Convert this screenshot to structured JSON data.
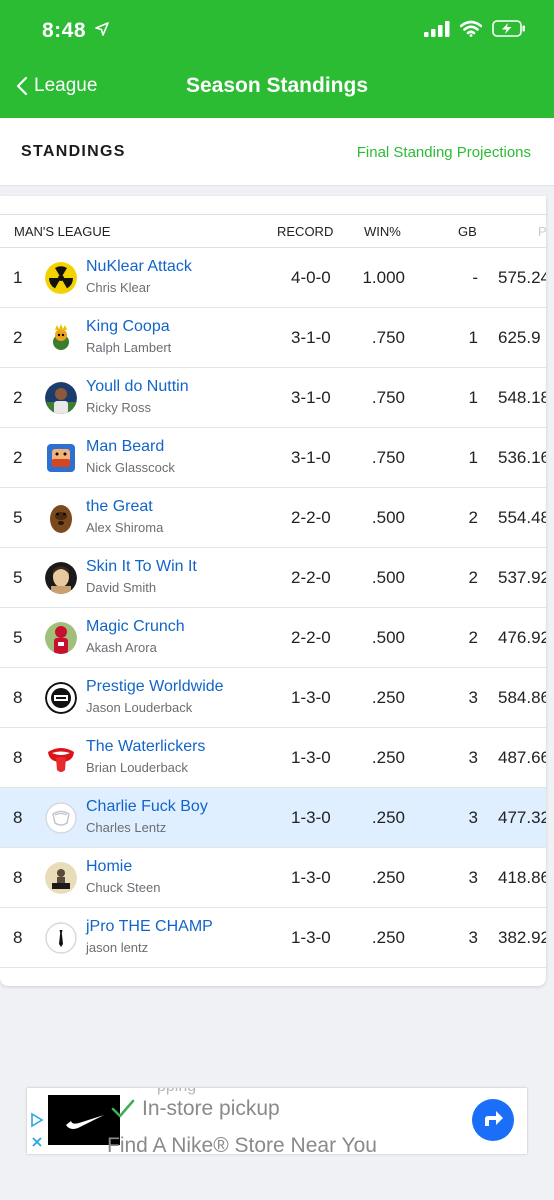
{
  "status_bar": {
    "time": "8:48"
  },
  "nav": {
    "back_label": "League",
    "title": "Season Standings"
  },
  "tabs": {
    "standings": "STANDINGS",
    "projections": "Final Standing Projections"
  },
  "table": {
    "headers": {
      "league": "MAN'S LEAGUE",
      "record": "RECORD",
      "winpct": "WIN%",
      "gb": "GB",
      "pf": "PF"
    },
    "rows": [
      {
        "rank": "1",
        "team": "NuKlear Attack",
        "owner": "Chris Klear",
        "record": "4-0-0",
        "winpct": "1.000",
        "gb": "-",
        "pf": "575.24",
        "logo_icon": "radiation-icon"
      },
      {
        "rank": "2",
        "team": "King Coopa",
        "owner": "Ralph Lambert",
        "record": "3-1-0",
        "winpct": ".750",
        "gb": "1",
        "pf": "625.9",
        "logo_icon": "koopa-king-icon"
      },
      {
        "rank": "2",
        "team": "Youll do Nuttin",
        "owner": "Ricky Ross",
        "record": "3-1-0",
        "winpct": ".750",
        "gb": "1",
        "pf": "548.18",
        "logo_icon": "player-photo-icon"
      },
      {
        "rank": "2",
        "team": "Man Beard",
        "owner": "Nick Glasscock",
        "record": "3-1-0",
        "winpct": ".750",
        "gb": "1",
        "pf": "536.16",
        "logo_icon": "beard-face-icon"
      },
      {
        "rank": "5",
        "team": "the Great",
        "owner": "Alex Shiroma",
        "record": "2-2-0",
        "winpct": ".500",
        "gb": "2",
        "pf": "554.48",
        "logo_icon": "wookiee-icon"
      },
      {
        "rank": "5",
        "team": "Skin It To Win It",
        "owner": "David Smith",
        "record": "2-2-0",
        "winpct": ".500",
        "gb": "2",
        "pf": "537.92",
        "logo_icon": "person-photo-icon"
      },
      {
        "rank": "5",
        "team": "Magic Crunch",
        "owner": "Akash Arora",
        "record": "2-2-0",
        "winpct": ".500",
        "gb": "2",
        "pf": "476.92",
        "logo_icon": "football-player-icon"
      },
      {
        "rank": "8",
        "team": "Prestige Worldwide",
        "owner": "Jason Louderback",
        "record": "1-3-0",
        "winpct": ".250",
        "gb": "3",
        "pf": "584.86",
        "logo_icon": "prestige-worldwide-badge-icon"
      },
      {
        "rank": "8",
        "team": "The Waterlickers",
        "owner": "Brian Louderback",
        "record": "1-3-0",
        "winpct": ".250",
        "gb": "3",
        "pf": "487.66",
        "logo_icon": "tongue-lips-icon"
      },
      {
        "rank": "8",
        "team": "Charlie Fuck Boy",
        "owner": "Charles Lentz",
        "record": "1-3-0",
        "winpct": ".250",
        "gb": "3",
        "pf": "477.32",
        "logo_icon": "default-shield-icon",
        "highlighted": true
      },
      {
        "rank": "8",
        "team": "Homie",
        "owner": "Chuck Steen",
        "record": "1-3-0",
        "winpct": ".250",
        "gb": "3",
        "pf": "418.86",
        "logo_icon": "homie-sign-icon"
      },
      {
        "rank": "8",
        "team": "jPro THE CHAMP",
        "owner": "jason lentz",
        "record": "1-3-0",
        "winpct": ".250",
        "gb": "3",
        "pf": "382.92",
        "logo_icon": "tie-icon"
      }
    ]
  },
  "ad": {
    "partial_text": "pping",
    "line1": "In-store pickup",
    "line2": "Find A Nike® Store Near You"
  },
  "colors": {
    "brand_green": "#2bbc34",
    "link_blue": "#1265c8",
    "highlight_row": "#e0efff",
    "ad_blue": "#1a6ef7"
  }
}
